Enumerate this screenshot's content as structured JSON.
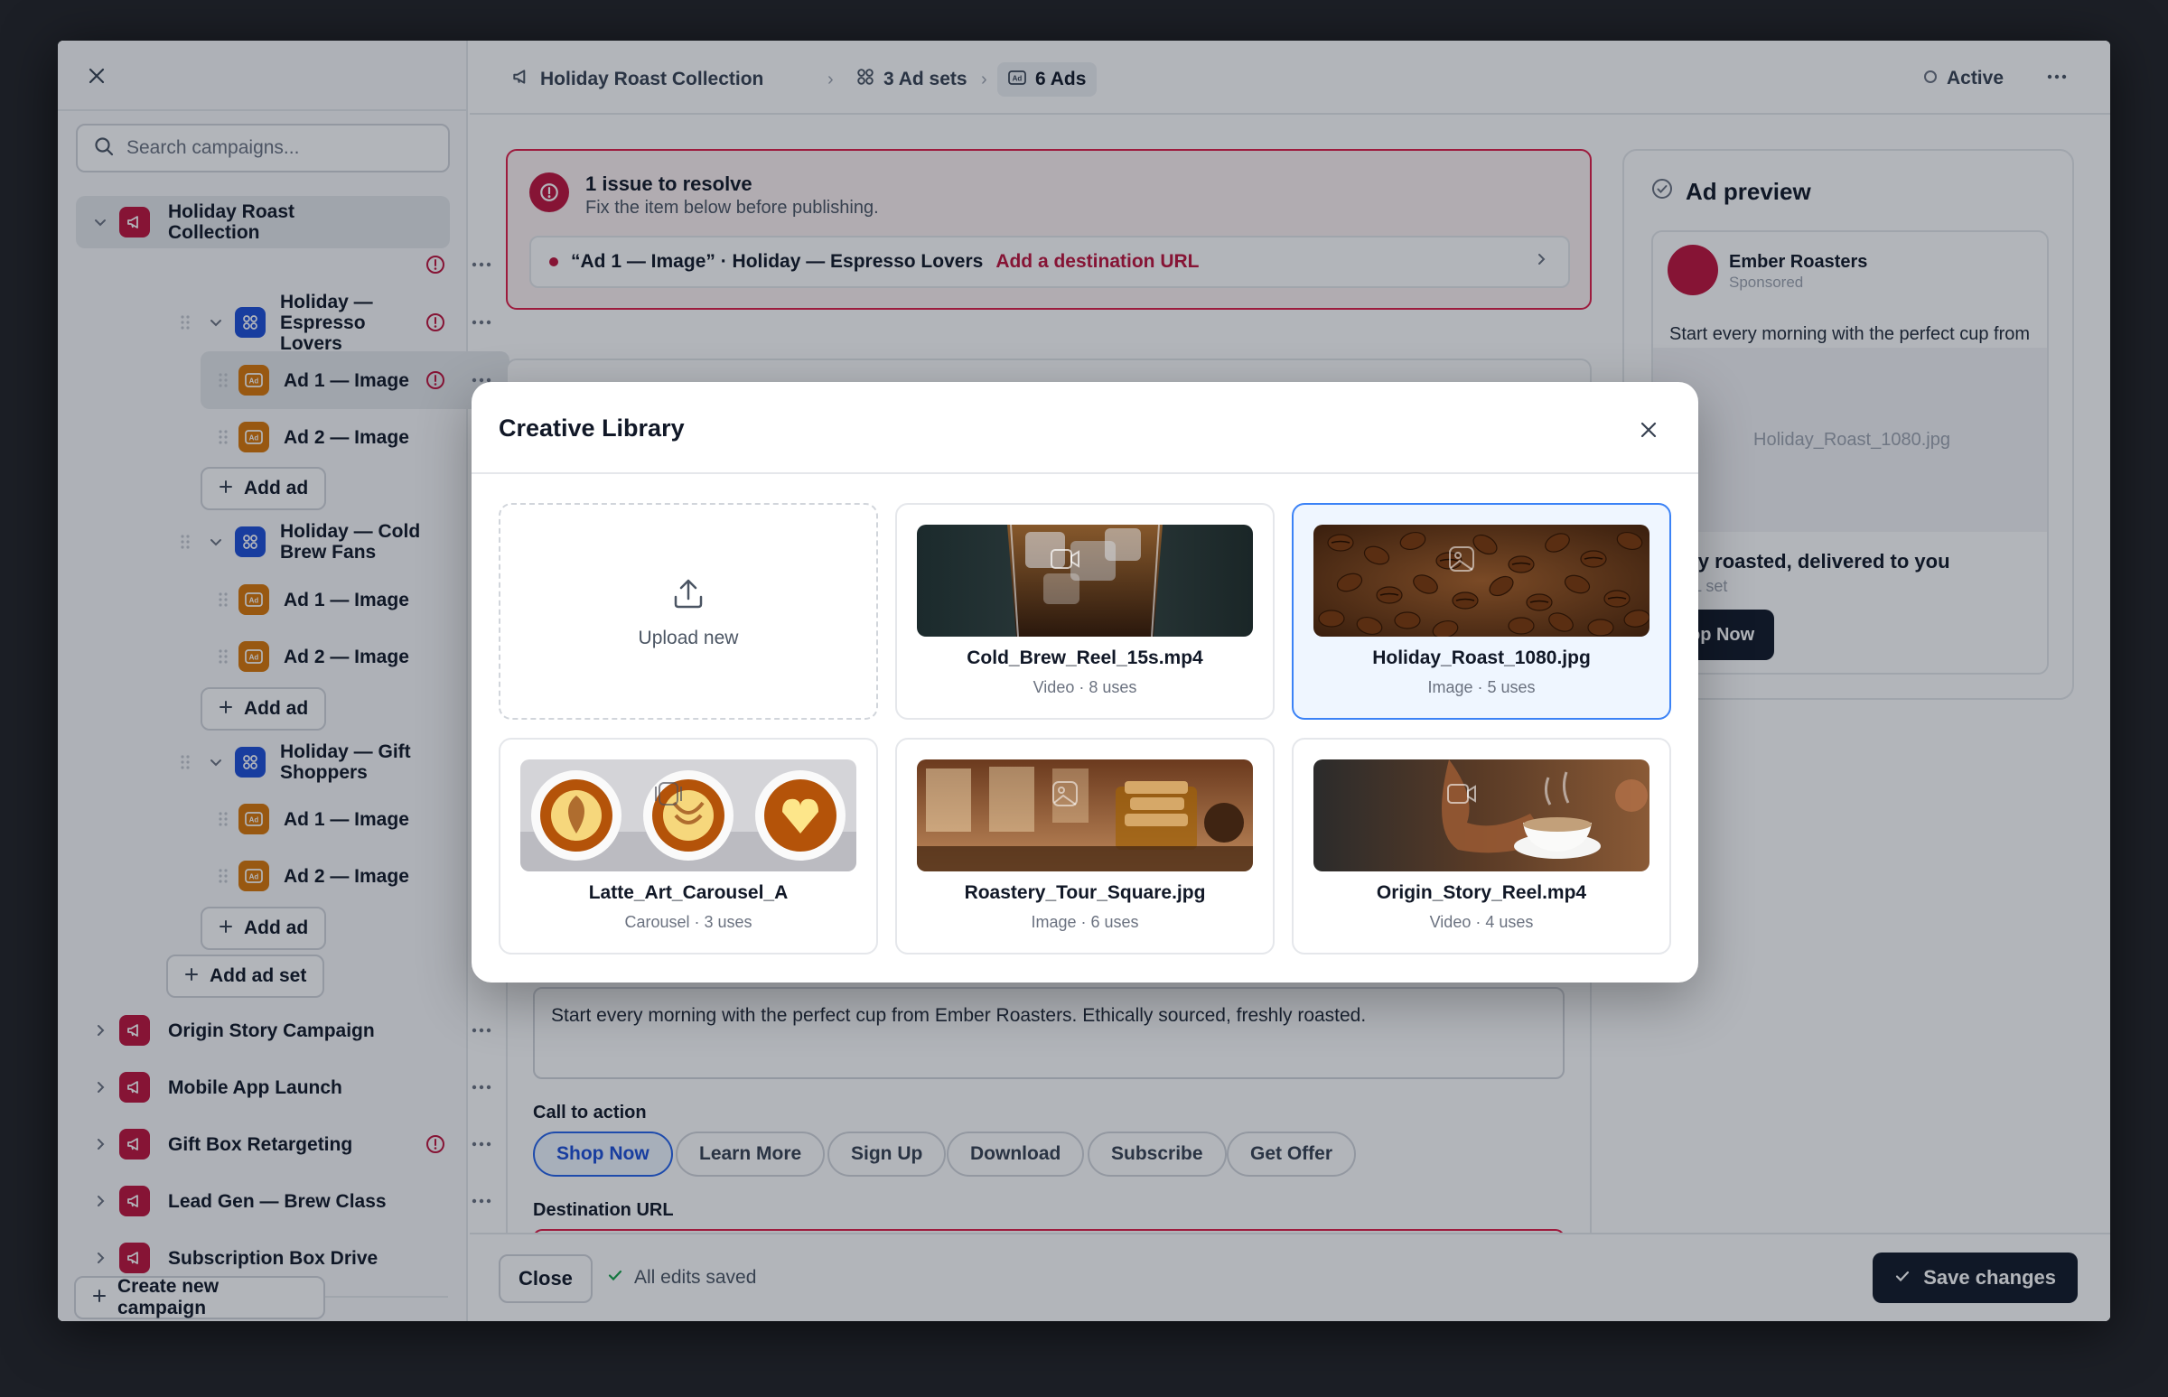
{
  "sidebar": {
    "search_placeholder": "Search campaigns...",
    "campaigns": [
      {
        "label": "Holiday Roast Collection",
        "label_line1": "Holiday Roast",
        "label_line2": "Collection"
      },
      {
        "label": "Origin Story Campaign"
      },
      {
        "label": "Mobile App Launch"
      },
      {
        "label": "Gift Box Retargeting"
      },
      {
        "label": "Lead Gen — Brew Class"
      },
      {
        "label": "Subscription Box Drive"
      }
    ],
    "ad_sets": [
      {
        "line1": "Holiday —",
        "line2": "Espresso",
        "line3": "Lovers"
      },
      {
        "line1": "Holiday — Cold",
        "line2": "Brew Fans"
      },
      {
        "line1": "Holiday — Gift",
        "line2": "Shoppers"
      }
    ],
    "ads": {
      "ad1": "Ad 1 — Image",
      "ad2": "Ad 2 — Image"
    },
    "add_ad": "Add ad",
    "add_ad_set": "Add ad set",
    "create_campaign": "Create new campaign"
  },
  "breadcrumb": {
    "campaign": "Holiday Roast Collection",
    "ad_sets": "3 Ad sets",
    "ads": "6 Ads"
  },
  "status": "Active",
  "alert": {
    "title": "1 issue to resolve",
    "subtitle": "Fix the item below before publishing.",
    "item_text": "“Ad 1 — Image” · Holiday — Espresso Lovers",
    "item_link": "Add a destination URL"
  },
  "editor": {
    "primary_text": "Start every morning with the perfect cup from Ember Roasters. Ethically sourced, freshly roasted.",
    "cta_label": "Call to action",
    "cta_options": [
      "Shop Now",
      "Learn More",
      "Sign Up",
      "Download",
      "Subscribe",
      "Get Offer"
    ],
    "cta_selected": "Shop Now",
    "url_label": "Destination URL"
  },
  "footer": {
    "close": "Close",
    "saved": "All edits saved",
    "save": "Save changes"
  },
  "preview": {
    "title": "Ad preview",
    "brand": "Ember Roasters",
    "sponsored": "Sponsored",
    "text": "Start every morning with the perfect cup from",
    "image": "Holiday_Roast_1080.jpg",
    "headline": "shly roasted, delivered to you",
    "url_note": "URL set",
    "button": "op Now"
  },
  "modal": {
    "title": "Creative Library",
    "upload": "Upload new",
    "assets": [
      {
        "name": "Cold_Brew_Reel_15s.mp4",
        "meta": "Video · 8 uses"
      },
      {
        "name": "Holiday_Roast_1080.jpg",
        "meta": "Image · 5 uses",
        "selected": true
      },
      {
        "name": "Latte_Art_Carousel_A",
        "meta": "Carousel · 3 uses"
      },
      {
        "name": "Roastery_Tour_Square.jpg",
        "meta": "Image · 6 uses"
      },
      {
        "name": "Origin_Story_Reel.mp4",
        "meta": "Video · 4 uses"
      }
    ]
  },
  "colors": {
    "accent": "#2563eb",
    "danger": "#be123c",
    "campaign_icon": "#be123c",
    "adset_icon": "#1d4ed8",
    "ad_icon": "#d97706",
    "primary_button": "#111827"
  },
  "icons": [
    "close-icon",
    "search-icon",
    "megaphone-icon",
    "grid-icon",
    "ad-icon",
    "alert-icon",
    "ellipsis-icon",
    "drag-handle-icon",
    "chevron-down-icon",
    "chevron-right-icon",
    "plus-icon",
    "upload-icon",
    "check-icon",
    "check-circle-icon",
    "video-icon",
    "image-icon",
    "carousel-icon",
    "status-circle-icon"
  ]
}
